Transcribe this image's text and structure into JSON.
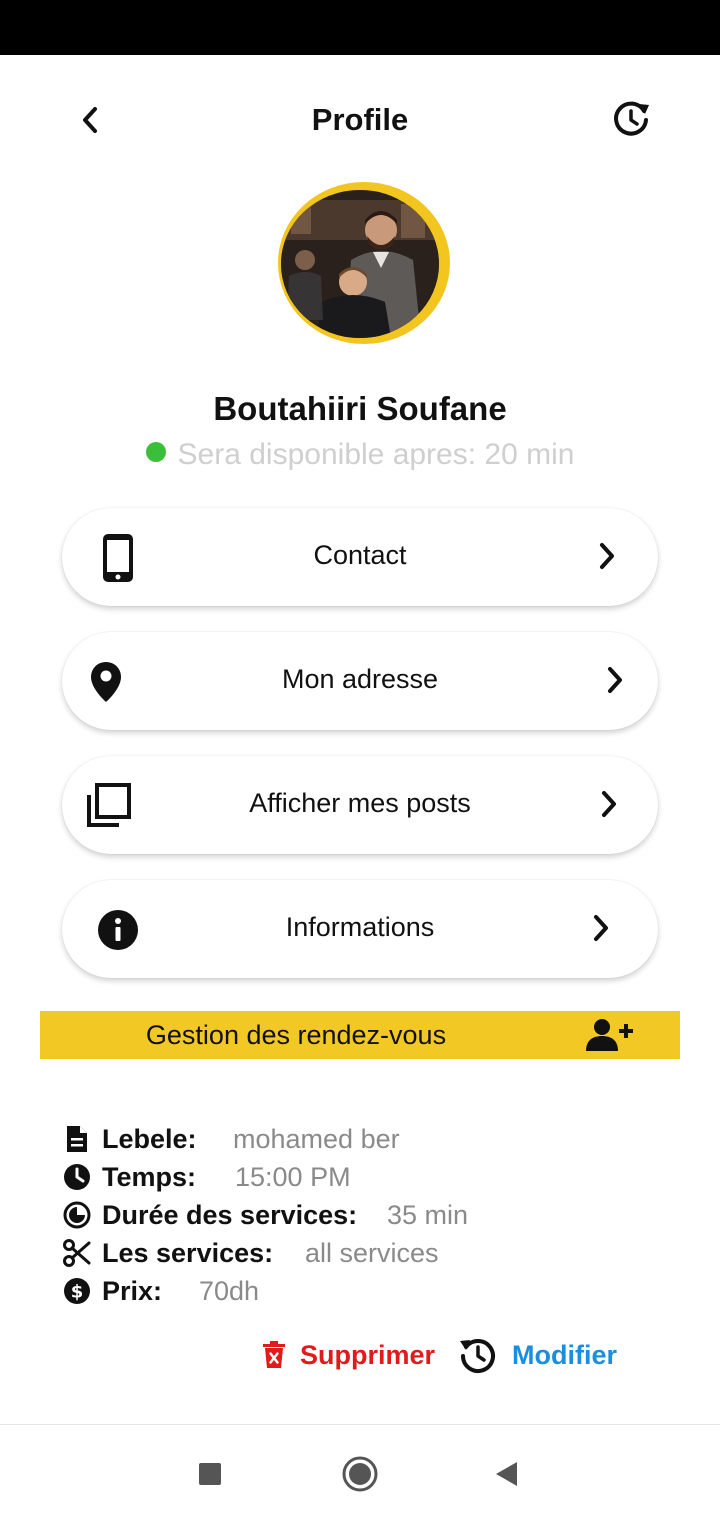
{
  "header": {
    "title": "Profile"
  },
  "profile": {
    "name": "Boutahiiri Soufane",
    "availability": "Sera disponible apres: 20 min"
  },
  "menu": {
    "items": [
      {
        "label": "Contact",
        "icon": "phone-icon"
      },
      {
        "label": "Mon adresse",
        "icon": "location-pin-icon"
      },
      {
        "label": "Afficher mes posts",
        "icon": "posts-icon"
      },
      {
        "label": "Informations",
        "icon": "info-icon"
      }
    ]
  },
  "rdv": {
    "label": "Gestion des rendez-vous"
  },
  "appointment": {
    "lebele": {
      "key": "Lebele:",
      "value": "mohamed ber"
    },
    "temps": {
      "key": "Temps:",
      "value": "15:00 PM"
    },
    "duree": {
      "key": "Durée des services:",
      "value": "35 min"
    },
    "services": {
      "key": "Les services:",
      "value": "all services"
    },
    "prix": {
      "key": "Prix:",
      "value": "70dh"
    }
  },
  "actions": {
    "delete_label": "Supprimer",
    "edit_label": "Modifier"
  },
  "colors": {
    "accent_yellow": "#f2c924",
    "delete_red": "#e01b1b",
    "edit_blue": "#1a8fe0",
    "online_green": "#3bbf3b"
  }
}
